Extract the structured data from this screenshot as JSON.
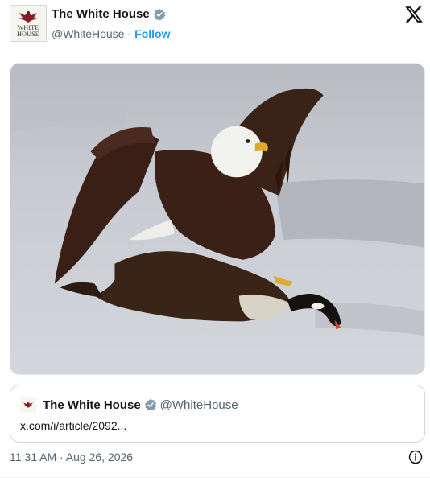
{
  "author": {
    "name": "The White House",
    "handle": "@WhiteHouse",
    "separator": "·",
    "follow_label": "Follow",
    "avatar_wordmark": [
      "WHITE",
      "HOUSE"
    ]
  },
  "media": {
    "icon": "bald-eagle-attacking-goose-photo"
  },
  "quoted_post": {
    "name": "The White House",
    "handle": "@WhiteHouse",
    "link_text": "x.com/i/article/2092..."
  },
  "footer": {
    "timestamp": "11:31 AM · Aug 26, 2026"
  },
  "colors": {
    "accent": "#1d9bf0",
    "text_primary": "#0f1419",
    "text_secondary": "#536471",
    "border": "#cfd9de"
  }
}
